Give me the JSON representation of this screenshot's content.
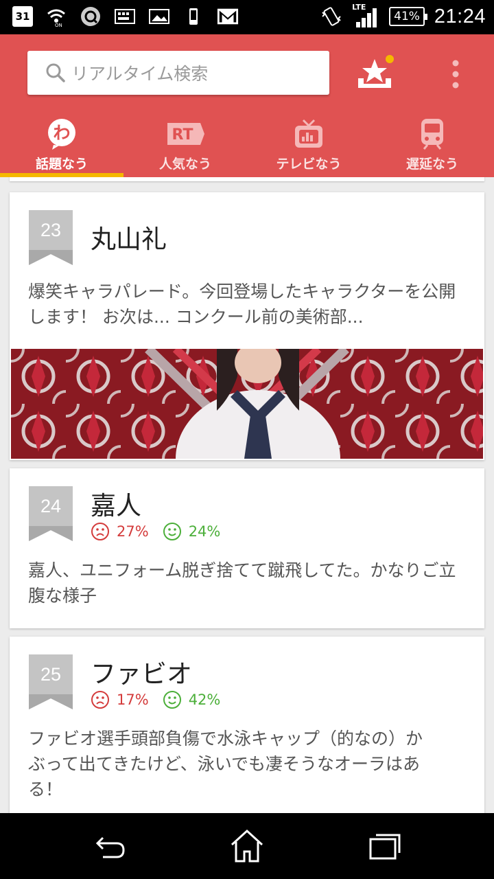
{
  "status_bar": {
    "calendar_day": "31",
    "network": "LTE",
    "battery": "41%",
    "time": "21:24",
    "icons": [
      "calendar-icon",
      "wifi-on-icon",
      "q-app-icon",
      "keyboard-icon",
      "photo-icon",
      "phone-icon",
      "gmail-icon",
      "vibrate-icon",
      "signal-icon",
      "battery-icon"
    ]
  },
  "header": {
    "search_placeholder": "リアルタイム検索",
    "search_icon": "search-icon",
    "favorites_icon": "star-tray-icon",
    "menu_icon": "more-vert-icon",
    "accent": "#e05252",
    "indicator_color": "#f5b800"
  },
  "tabs": [
    {
      "label": "話題なう",
      "icon": "wa-icon",
      "active": true
    },
    {
      "label": "人気なう",
      "icon": "rt-icon",
      "active": false
    },
    {
      "label": "テレビなう",
      "icon": "tv-icon",
      "active": false
    },
    {
      "label": "遅延なう",
      "icon": "train-icon",
      "active": false
    }
  ],
  "cards": [
    {
      "rank": "23",
      "title": "丸山礼",
      "desc": "爆笑キャラパレード。今回登場したキャラクターを公開します！ お次は... コンクール前の美術部...",
      "has_image": true
    },
    {
      "rank": "24",
      "title": "嘉人",
      "negative": "27%",
      "positive": "24%",
      "desc": "嘉人、ユニフォーム脱ぎ捨てて蹴飛してた。かなりご立腹な様子"
    },
    {
      "rank": "25",
      "title": "ファビオ",
      "negative": "17%",
      "positive": "42%",
      "desc": "ファビオ選手頭部負傷で水泳キャップ（的なの）かぶって出てきたけど、泳いでも凄そうなオーラはある！"
    }
  ],
  "nav": {
    "back": "back-icon",
    "home": "home-icon",
    "recents": "recents-icon"
  }
}
